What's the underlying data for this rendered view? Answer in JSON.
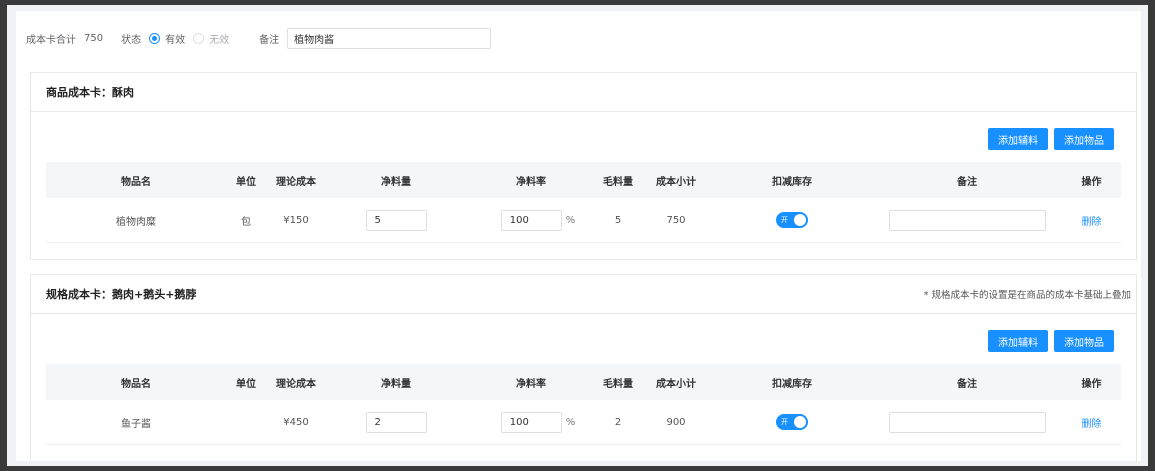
{
  "summary": {
    "total_label": "成本卡合计",
    "total_value": "750",
    "status_label": "状态",
    "status_options": [
      {
        "label": "有效",
        "selected": true
      },
      {
        "label": "无效",
        "selected": false
      }
    ],
    "remark_label": "备注",
    "remark_value": "植物肉酱"
  },
  "columns": [
    "物品名",
    "单位",
    "理论成本",
    "净料量",
    "净料率",
    "毛料量",
    "成本小计",
    "扣减库存",
    "备注",
    "操作"
  ],
  "buttons": {
    "add_aux": "添加辅料",
    "add_item": "添加物品"
  },
  "cards": [
    {
      "title": "商品成本卡：酥肉",
      "note": "",
      "rows": [
        {
          "name": "植物肉糜",
          "unit": "包",
          "theory_cost": "¥150",
          "net_qty": "5",
          "net_rate": "100",
          "rate_unit": "%",
          "gross_qty": "5",
          "subtotal": "750",
          "switch_label": "开",
          "remark": "",
          "action": "删除"
        }
      ]
    },
    {
      "title": "规格成本卡：鹅肉+鹅头+鹅脖",
      "note": "* 规格成本卡的设置是在商品的成本卡基础上叠加",
      "rows": [
        {
          "name": "鱼子酱",
          "unit": "",
          "theory_cost": "¥450",
          "net_qty": "2",
          "net_rate": "100",
          "rate_unit": "%",
          "gross_qty": "2",
          "subtotal": "900",
          "switch_label": "开",
          "remark": "",
          "action": "删除"
        }
      ]
    }
  ],
  "colors": {
    "primary": "#1890ff",
    "table_head_bg": "#f5f6f8",
    "page_bg": "#f0f2f5"
  }
}
